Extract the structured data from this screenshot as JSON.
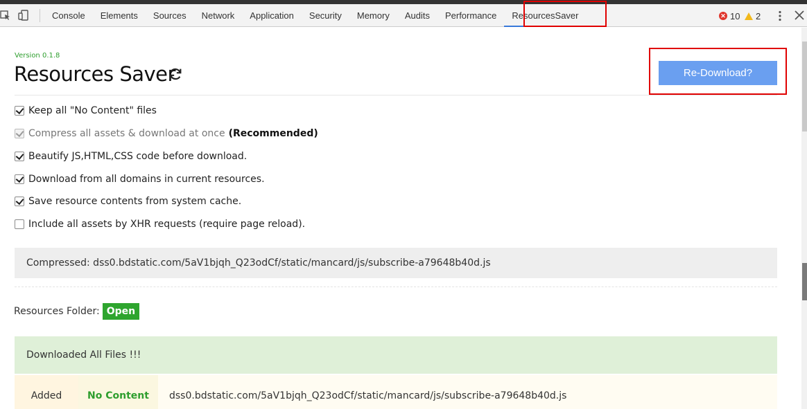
{
  "devtools": {
    "tabs": [
      {
        "label": "Console"
      },
      {
        "label": "Elements"
      },
      {
        "label": "Sources"
      },
      {
        "label": "Network"
      },
      {
        "label": "Application"
      },
      {
        "label": "Security"
      },
      {
        "label": "Memory"
      },
      {
        "label": "Audits"
      },
      {
        "label": "Performance"
      },
      {
        "label": "ResourcesSaver",
        "active": true
      }
    ],
    "error_count": "10",
    "warning_count": "2",
    "error_icon_glyph": "✕",
    "colors": {
      "error": "#e0362d",
      "warning": "#f2b91c",
      "active_tab_underline": "#3879d9"
    }
  },
  "extension": {
    "version": "Version 0.1.8",
    "title": "Resources Saver",
    "redownload_label": "Re-Download?",
    "options": [
      {
        "label": "Keep all \"No Content\" files",
        "checked": true,
        "disabled": false,
        "suffix": ""
      },
      {
        "label": "Compress all assets & download at once",
        "checked": true,
        "disabled": true,
        "suffix": "(Recommended)"
      },
      {
        "label": "Beautify JS,HTML,CSS code before download.",
        "checked": true,
        "disabled": false,
        "suffix": ""
      },
      {
        "label": "Download from all domains in current resources.",
        "checked": true,
        "disabled": false,
        "suffix": ""
      },
      {
        "label": "Save resource contents from system cache.",
        "checked": true,
        "disabled": false,
        "suffix": ""
      },
      {
        "label": "Include all assets by XHR requests (require page reload).",
        "checked": false,
        "disabled": false,
        "suffix": ""
      }
    ],
    "compressed_status": "Compressed: dss0.bdstatic.com/5aV1bjqh_Q23odCf/static/mancard/js/subscribe-a79648b40d.js",
    "resources_folder_label": "Resources Folder:",
    "open_label": "Open",
    "downloaded_message": "Downloaded All Files !!!",
    "files": [
      {
        "status": "Added",
        "content": "No Content",
        "url": "dss0.bdstatic.com/5aV1bjqh_Q23odCf/static/mancard/js/subscribe-a79648b40d.js"
      }
    ],
    "colors": {
      "version": "#2e9e2e",
      "button": "#6a9ff0",
      "open": "#2ea52e",
      "success_bg": "#dff0d8"
    }
  }
}
